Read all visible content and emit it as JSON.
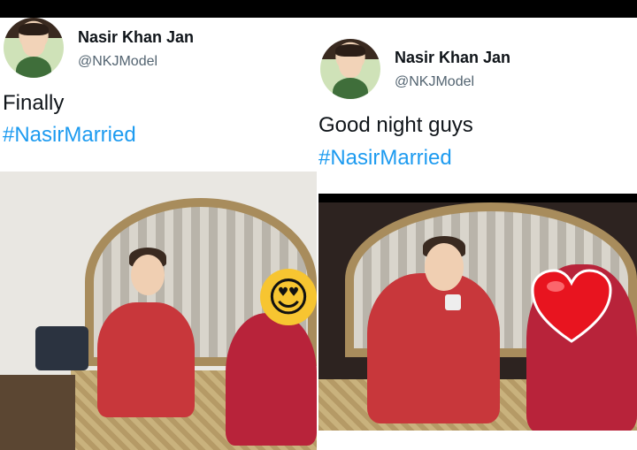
{
  "tweets": [
    {
      "user": {
        "name": "Nasir Khan Jan",
        "handle": "@NKJModel"
      },
      "text": "Finally",
      "hashtag": "#NasirMarried",
      "photo_overlay_emoji": "😍"
    },
    {
      "user": {
        "name": "Nasir Khan Jan",
        "handle": "@NKJModel"
      },
      "text": "Good night guys",
      "hashtag": "#NasirMarried",
      "photo_overlay_emoji": "❤️"
    }
  ],
  "colors": {
    "hashtag": "#1d9bf0",
    "name": "#0f1419",
    "handle": "#536471",
    "groom_outfit": "#c8373b",
    "bride_outfit": "#b8233a"
  },
  "icons": [
    "avatar",
    "heart-eyes-emoji",
    "red-heart-emoji"
  ]
}
